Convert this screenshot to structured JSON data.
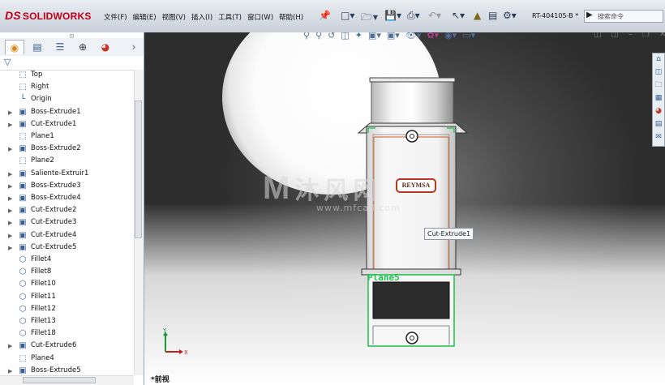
{
  "app": {
    "logo_text": "SOLIDWORKS",
    "logo_mark": "DS",
    "document_name": "RT-404105-B *",
    "search_placeholder": "搜索命令"
  },
  "menu": [
    "文件(F)",
    "编辑(E)",
    "视图(V)",
    "插入(I)",
    "工具(T)",
    "窗口(W)",
    "帮助(H)"
  ],
  "feature_tree": {
    "items": [
      {
        "label": "Top",
        "icon": "plane-icon",
        "expandable": false
      },
      {
        "label": "Right",
        "icon": "plane-icon",
        "expandable": false
      },
      {
        "label": "Origin",
        "icon": "origin-icon",
        "expandable": false
      },
      {
        "label": "Boss-Extrude1",
        "icon": "extrude-icon",
        "expandable": true
      },
      {
        "label": "Cut-Extrude1",
        "icon": "extrude-icon",
        "expandable": true
      },
      {
        "label": "Plane1",
        "icon": "plane-icon",
        "expandable": false
      },
      {
        "label": "Boss-Extrude2",
        "icon": "extrude-icon",
        "expandable": true
      },
      {
        "label": "Plane2",
        "icon": "plane-icon",
        "expandable": false
      },
      {
        "label": "Saliente-Extruir1",
        "icon": "extrude-icon",
        "expandable": true
      },
      {
        "label": "Boss-Extrude3",
        "icon": "extrude-icon",
        "expandable": true
      },
      {
        "label": "Boss-Extrude4",
        "icon": "extrude-icon",
        "expandable": true
      },
      {
        "label": "Cut-Extrude2",
        "icon": "extrude-icon",
        "expandable": true
      },
      {
        "label": "Cut-Extrude3",
        "icon": "extrude-icon",
        "expandable": true
      },
      {
        "label": "Cut-Extrude4",
        "icon": "extrude-icon",
        "expandable": true
      },
      {
        "label": "Cut-Extrude5",
        "icon": "extrude-icon",
        "expandable": true
      },
      {
        "label": "Fillet4",
        "icon": "fillet-icon",
        "expandable": false
      },
      {
        "label": "Fillet8",
        "icon": "fillet-icon",
        "expandable": false
      },
      {
        "label": "Fillet10",
        "icon": "fillet-icon",
        "expandable": false
      },
      {
        "label": "Fillet11",
        "icon": "fillet-icon",
        "expandable": false
      },
      {
        "label": "Fillet12",
        "icon": "fillet-icon",
        "expandable": false
      },
      {
        "label": "Fillet13",
        "icon": "fillet-icon",
        "expandable": false
      },
      {
        "label": "Fillet18",
        "icon": "fillet-icon",
        "expandable": false
      },
      {
        "label": "Cut-Extrude6",
        "icon": "extrude-icon",
        "expandable": true
      },
      {
        "label": "Plane4",
        "icon": "plane-icon",
        "expandable": false
      },
      {
        "label": "Boss-Extrude5",
        "icon": "extrude-icon",
        "expandable": true
      }
    ]
  },
  "viewport": {
    "tooltip": "Cut-Extrude1",
    "plane_label": "Plane5",
    "brand_text": "REYMSA",
    "view_label": "*前视",
    "axis_x": "X",
    "axis_y": "Y",
    "watermark_main": "沐风网",
    "watermark_url": "www.mfcad.com"
  },
  "colors": {
    "logo_red": "#c0001a",
    "plane_green": "#1fbf4d",
    "highlight_orange": "#d45a1a"
  }
}
